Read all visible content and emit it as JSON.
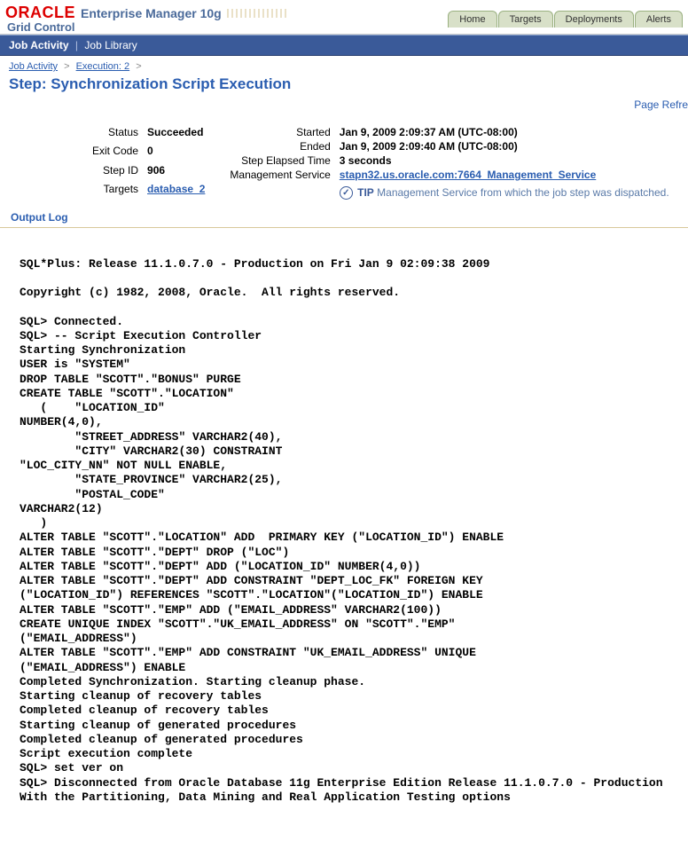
{
  "brand": {
    "oracle": "ORACLE",
    "em": "Enterprise Manager 10g",
    "subtitle": "Grid Control"
  },
  "main_tabs": {
    "items": [
      "Home",
      "Targets",
      "Deployments",
      "Alerts"
    ]
  },
  "subnav": {
    "items": [
      "Job Activity",
      "Job Library"
    ],
    "active_index": 0
  },
  "breadcrumb": {
    "items": [
      "Job Activity",
      "Execution: 2"
    ],
    "gt": ">"
  },
  "page": {
    "title": "Step: Synchronization Script Execution",
    "refresh": "Page Refre"
  },
  "left_kv": {
    "status_label": "Status",
    "status_value": "Succeeded",
    "exit_label": "Exit Code",
    "exit_value": "0",
    "stepid_label": "Step ID",
    "stepid_value": "906",
    "targets_label": "Targets",
    "targets_value": "database_2"
  },
  "right_kv": {
    "started_label": "Started",
    "started_value": "Jan 9, 2009 2:09:37 AM (UTC-08:00)",
    "ended_label": "Ended",
    "ended_value": "Jan 9, 2009 2:09:40 AM (UTC-08:00)",
    "step_elapsed_label": "Step Elapsed Time",
    "step_elapsed_value": "3 seconds",
    "mgmt_label": "Management Service",
    "mgmt_value": "stapn32.us.oracle.com:7664_Management_Service"
  },
  "tip": {
    "label": "TIP",
    "text": "Management Service from which the job step was dispatched."
  },
  "output_section": {
    "title": "Output Log"
  },
  "output_log": "\nSQL*Plus: Release 11.1.0.7.0 - Production on Fri Jan 9 02:09:38 2009\n\nCopyright (c) 1982, 2008, Oracle.  All rights reserved.\n\nSQL> Connected.\nSQL> -- Script Execution Controller\nStarting Synchronization\nUSER is \"SYSTEM\"\nDROP TABLE \"SCOTT\".\"BONUS\" PURGE\nCREATE TABLE \"SCOTT\".\"LOCATION\"\n   (    \"LOCATION_ID\"\nNUMBER(4,0),\n        \"STREET_ADDRESS\" VARCHAR2(40),\n        \"CITY\" VARCHAR2(30) CONSTRAINT\n\"LOC_CITY_NN\" NOT NULL ENABLE,\n        \"STATE_PROVINCE\" VARCHAR2(25),\n        \"POSTAL_CODE\"\nVARCHAR2(12)\n   )\nALTER TABLE \"SCOTT\".\"LOCATION\" ADD  PRIMARY KEY (\"LOCATION_ID\") ENABLE\nALTER TABLE \"SCOTT\".\"DEPT\" DROP (\"LOC\")\nALTER TABLE \"SCOTT\".\"DEPT\" ADD (\"LOCATION_ID\" NUMBER(4,0))\nALTER TABLE \"SCOTT\".\"DEPT\" ADD CONSTRAINT \"DEPT_LOC_FK\" FOREIGN KEY\n(\"LOCATION_ID\") REFERENCES \"SCOTT\".\"LOCATION\"(\"LOCATION_ID\") ENABLE\nALTER TABLE \"SCOTT\".\"EMP\" ADD (\"EMAIL_ADDRESS\" VARCHAR2(100))\nCREATE UNIQUE INDEX \"SCOTT\".\"UK_EMAIL_ADDRESS\" ON \"SCOTT\".\"EMP\"\n(\"EMAIL_ADDRESS\")\nALTER TABLE \"SCOTT\".\"EMP\" ADD CONSTRAINT \"UK_EMAIL_ADDRESS\" UNIQUE\n(\"EMAIL_ADDRESS\") ENABLE\nCompleted Synchronization. Starting cleanup phase.\nStarting cleanup of recovery tables\nCompleted cleanup of recovery tables\nStarting cleanup of generated procedures\nCompleted cleanup of generated procedures\nScript execution complete\nSQL> set ver on\nSQL> Disconnected from Oracle Database 11g Enterprise Edition Release 11.1.0.7.0 - Production\nWith the Partitioning, Data Mining and Real Application Testing options"
}
